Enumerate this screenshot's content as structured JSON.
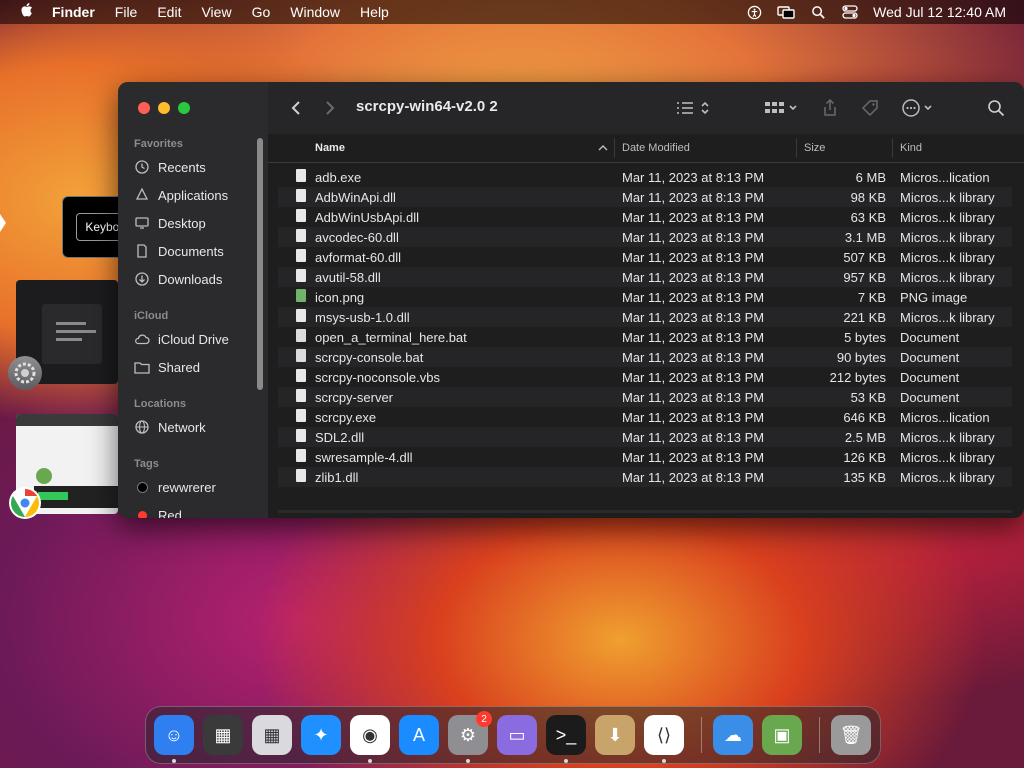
{
  "menubar": {
    "app_name": "Finder",
    "items": [
      "File",
      "Edit",
      "View",
      "Go",
      "Window",
      "Help"
    ],
    "clock": "Wed Jul 12  12:40 AM",
    "status_icons": [
      "accessibility-icon",
      "screen-mirroring-icon",
      "search-icon",
      "control-center-icon"
    ]
  },
  "tooltip": {
    "label": "Keyboard"
  },
  "window": {
    "title": "scrcpy-win64-v2.0 2",
    "traffic_colors": [
      "#ff5f57",
      "#febc2e",
      "#28c840"
    ],
    "sidebar": {
      "favorites_label": "Favorites",
      "favorites": [
        {
          "label": "Recents",
          "icon": "clock-icon"
        },
        {
          "label": "Applications",
          "icon": "applications-icon"
        },
        {
          "label": "Desktop",
          "icon": "desktop-icon"
        },
        {
          "label": "Documents",
          "icon": "document-icon"
        },
        {
          "label": "Downloads",
          "icon": "download-icon"
        }
      ],
      "icloud_label": "iCloud",
      "icloud": [
        {
          "label": "iCloud Drive",
          "icon": "cloud-icon"
        },
        {
          "label": "Shared",
          "icon": "shared-folder-icon"
        }
      ],
      "locations_label": "Locations",
      "locations": [
        {
          "label": "Network",
          "icon": "globe-icon"
        }
      ],
      "tags_label": "Tags",
      "tags": [
        {
          "label": "rewwrerer",
          "color": "#000000"
        },
        {
          "label": "Red",
          "color": "#ff3b30"
        }
      ]
    },
    "columns": {
      "name": "Name",
      "date": "Date Modified",
      "size": "Size",
      "kind": "Kind"
    },
    "files": [
      {
        "name": "adb.exe",
        "date": "Mar 11, 2023 at 8:13 PM",
        "size": "6 MB",
        "kind": "Micros...lication",
        "type": "doc"
      },
      {
        "name": "AdbWinApi.dll",
        "date": "Mar 11, 2023 at 8:13 PM",
        "size": "98 KB",
        "kind": "Micros...k library",
        "type": "doc"
      },
      {
        "name": "AdbWinUsbApi.dll",
        "date": "Mar 11, 2023 at 8:13 PM",
        "size": "63 KB",
        "kind": "Micros...k library",
        "type": "doc"
      },
      {
        "name": "avcodec-60.dll",
        "date": "Mar 11, 2023 at 8:13 PM",
        "size": "3.1 MB",
        "kind": "Micros...k library",
        "type": "doc"
      },
      {
        "name": "avformat-60.dll",
        "date": "Mar 11, 2023 at 8:13 PM",
        "size": "507 KB",
        "kind": "Micros...k library",
        "type": "doc"
      },
      {
        "name": "avutil-58.dll",
        "date": "Mar 11, 2023 at 8:13 PM",
        "size": "957 KB",
        "kind": "Micros...k library",
        "type": "doc"
      },
      {
        "name": "icon.png",
        "date": "Mar 11, 2023 at 8:13 PM",
        "size": "7 KB",
        "kind": "PNG image",
        "type": "img"
      },
      {
        "name": "msys-usb-1.0.dll",
        "date": "Mar 11, 2023 at 8:13 PM",
        "size": "221 KB",
        "kind": "Micros...k library",
        "type": "doc"
      },
      {
        "name": "open_a_terminal_here.bat",
        "date": "Mar 11, 2023 at 8:13 PM",
        "size": "5 bytes",
        "kind": "Document",
        "type": "bat"
      },
      {
        "name": "scrcpy-console.bat",
        "date": "Mar 11, 2023 at 8:13 PM",
        "size": "90 bytes",
        "kind": "Document",
        "type": "bat"
      },
      {
        "name": "scrcpy-noconsole.vbs",
        "date": "Mar 11, 2023 at 8:13 PM",
        "size": "212 bytes",
        "kind": "Document",
        "type": "doc"
      },
      {
        "name": "scrcpy-server",
        "date": "Mar 11, 2023 at 8:13 PM",
        "size": "53 KB",
        "kind": "Document",
        "type": "doc"
      },
      {
        "name": "scrcpy.exe",
        "date": "Mar 11, 2023 at 8:13 PM",
        "size": "646 KB",
        "kind": "Micros...lication",
        "type": "doc"
      },
      {
        "name": "SDL2.dll",
        "date": "Mar 11, 2023 at 8:13 PM",
        "size": "2.5 MB",
        "kind": "Micros...k library",
        "type": "doc"
      },
      {
        "name": "swresample-4.dll",
        "date": "Mar 11, 2023 at 8:13 PM",
        "size": "126 KB",
        "kind": "Micros...k library",
        "type": "doc"
      },
      {
        "name": "zlib1.dll",
        "date": "Mar 11, 2023 at 8:13 PM",
        "size": "135 KB",
        "kind": "Micros...k library",
        "type": "doc"
      }
    ]
  },
  "dock": {
    "apps": [
      {
        "name": "finder",
        "icon": "finder-icon",
        "color": "#2f7ff0",
        "running": true
      },
      {
        "name": "mission-control",
        "icon": "mission-control-icon",
        "color": "#3a3a3a",
        "running": false
      },
      {
        "name": "launchpad",
        "icon": "launchpad-icon",
        "color": "#d9d9de",
        "running": false
      },
      {
        "name": "safari",
        "icon": "safari-icon",
        "color": "#1e90ff",
        "running": false
      },
      {
        "name": "chrome",
        "icon": "chrome-icon",
        "color": "#ffffff",
        "running": true
      },
      {
        "name": "app-store",
        "icon": "app-store-icon",
        "color": "#1a8cff",
        "running": false
      },
      {
        "name": "system-settings",
        "icon": "gear-icon",
        "color": "#8e8e93",
        "running": true,
        "badge": "2"
      },
      {
        "name": "simulator",
        "icon": "simulator-icon",
        "color": "#8a6be0",
        "running": false
      },
      {
        "name": "terminal",
        "icon": "terminal-icon",
        "color": "#1b1b1b",
        "running": true
      },
      {
        "name": "installer",
        "icon": "installer-icon",
        "color": "#c9a46a",
        "running": false
      },
      {
        "name": "vscode",
        "icon": "vscode-icon",
        "color": "#ffffff",
        "running": true
      },
      {
        "name": "weather",
        "icon": "weather-icon",
        "color": "#3b8ee8",
        "running": false
      },
      {
        "name": "minecraft",
        "icon": "minecraft-icon",
        "color": "#6aa84f",
        "running": false
      },
      {
        "name": "trash",
        "icon": "trash-icon",
        "color": "#9a9a9a",
        "running": false
      }
    ]
  }
}
